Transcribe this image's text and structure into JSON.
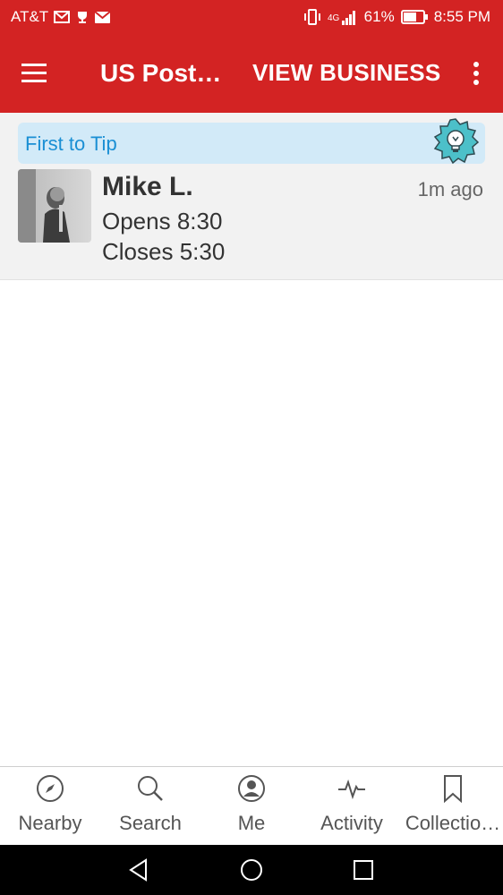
{
  "status_bar": {
    "carrier": "AT&T",
    "battery": "61%",
    "time": "8:55 PM"
  },
  "toolbar": {
    "title": "US Post…",
    "action": "VIEW BUSINESS"
  },
  "tip": {
    "badge": "First to Tip",
    "user": "Mike L.",
    "time": "1m ago",
    "lines": [
      "Opens 8:30",
      "Closes 5:30"
    ]
  },
  "tabs": [
    {
      "label": "Nearby",
      "icon": "compass-icon"
    },
    {
      "label": "Search",
      "icon": "search-icon"
    },
    {
      "label": "Me",
      "icon": "profile-icon"
    },
    {
      "label": "Activity",
      "icon": "activity-icon"
    },
    {
      "label": "Collectio…",
      "icon": "bookmark-icon"
    }
  ],
  "colors": {
    "brand_red": "#d32323",
    "badge_bg": "#d2eaf8",
    "badge_text": "#1a8fd4"
  }
}
